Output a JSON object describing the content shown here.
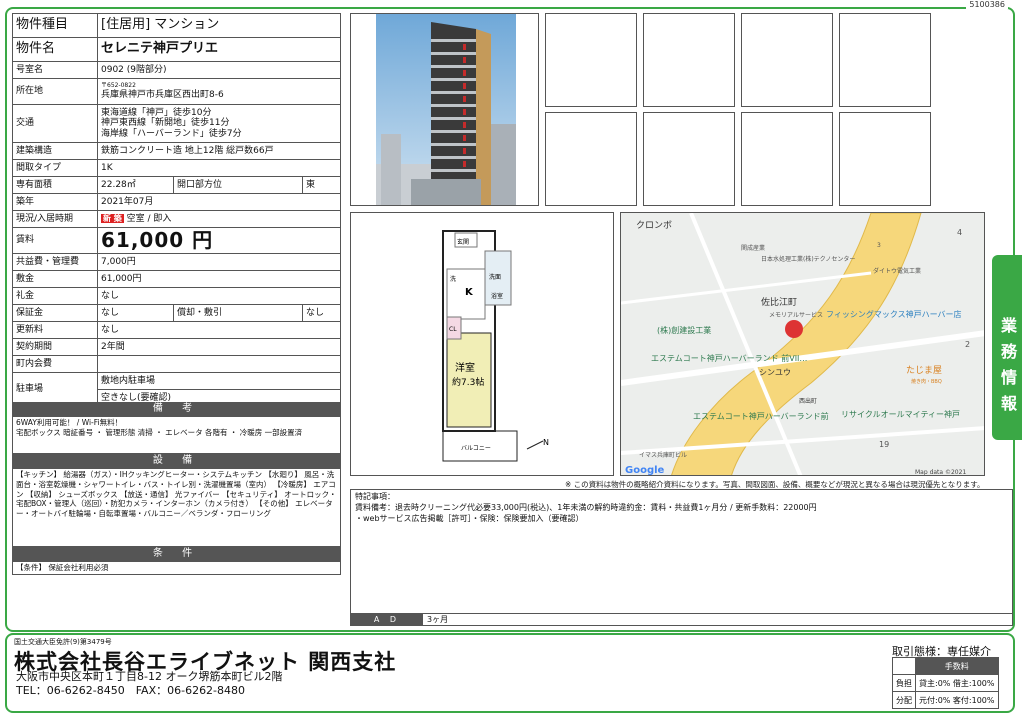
{
  "doc_id": "5100386",
  "property": {
    "type_label": "物件種目",
    "type_value": "[住居用] マンション",
    "name_label": "物件名",
    "name_value": "セレニテ神戸プリエ",
    "room_label": "号室名",
    "room_value": "0902 (9階部分)",
    "location_label": "所在地",
    "zip": "〒652-0822",
    "address": "兵庫県神戸市兵庫区西出町8-6",
    "access_label": "交通",
    "access": [
      "東海道線「神戸」徒歩10分",
      "神戸東西線「新開地」徒歩11分",
      "海岸線「ハーバーランド」徒歩7分"
    ],
    "structure_label": "建築構造",
    "structure_value": "鉄筋コンクリート造 地上12階 総戸数66戸",
    "layout_label": "間取タイプ",
    "layout_value": "1K",
    "area_label": "専有面積",
    "area_value": "22.28㎡",
    "direction_label": "開口部方位",
    "direction_value": "東",
    "built_label": "築年",
    "built_value": "2021年07月",
    "status_label": "現況/入居時期",
    "status_badge": "新 築",
    "status_value": "空室 / 即入",
    "rent_label": "賃料",
    "rent_value": "61,000 円",
    "common_label": "共益費・管理費",
    "common_value": "7,000円",
    "deposit_label": "敷金",
    "deposit_value": "61,000円",
    "key_money_label": "礼金",
    "key_money_value": "なし",
    "guarantee_label": "保証金",
    "guarantee_value": "なし",
    "amort_label": "償却・敷引",
    "amort_value": "なし",
    "renewal_label": "更新料",
    "renewal_value": "なし",
    "contract_label": "契約期間",
    "contract_value": "2年間",
    "town_fee_label": "町内会費",
    "town_fee_value": "",
    "parking_label": "駐車場",
    "parking_value1": "敷地内駐車場",
    "parking_value2": "空きなし(要確認)"
  },
  "remarks": {
    "title": "備 考",
    "text": "6WAY利用可能！ / Wi-Fi無料！\n宅配ボックス 暗証番号 ・ 管理形態 清掃 ・ エレベータ 各階有 ・ 冷暖房 一部設置済"
  },
  "facilities": {
    "title": "設 備",
    "text": "【キッチン】 給湯器（ガス）・IHクッキングヒーター・システムキッチン 【水廻り】 風呂・洗面台・浴室乾燥機・シャワートイレ・バス・トイレ別・洗濯機置場（室内） 【冷暖房】 エアコン 【収納】 シューズボックス 【放送・通信】 光ファイバー 【セキュリティ】 オートロック・宅配BOX・管理人（巡回）・防犯カメラ・インターホン（カメラ付き） 【その他】 エレベーター・オートバイ駐輪場・自転車置場・バルコニー／ベランダ・フローリング"
  },
  "conditions": {
    "title": "条 件",
    "text": "【条件】 保証会社利用必須"
  },
  "floorplan": {
    "entrance": "玄関",
    "kitchen": "K",
    "wash": "洗",
    "cl": "CL",
    "bath": "浴室",
    "washroom": "洗面",
    "room": "洋室",
    "room_size": "約7.3帖",
    "balcony": "バルコニー",
    "north": "N"
  },
  "map": {
    "labels": [
      "クロンボ",
      "関成産業",
      "日本水処理工業(株)テクノセンター",
      "ダイトウ電気工業",
      "佐比江町",
      "メモリアルサービス",
      "フィッシングマックス神戸ハーバー店",
      "(株)創建設工業",
      "エステムコート神戸ハーバーランド 前VII…",
      "シンユウ",
      "たじま屋",
      "焼き肉・BBQ",
      "西出町",
      "リサイクルオールマイティー神戸",
      "エステムコート神戸ハーバーランド前",
      "イマス兵庫町ビル"
    ],
    "route_no": "3",
    "num4": "4",
    "num2": "2",
    "num19": "19",
    "google": "Google",
    "copyright": "Map data ©2021"
  },
  "disclaimer": "※ この資料は物件の概略紹介資料になります。写真、間取図面、設備、概要などが現況と異なる場合は現況優先となります。",
  "special_notes": {
    "title": "特記事項：",
    "line1": "賃料備考：退去時クリーニング代必要33,000円(税込)、1年未満の解約時違約金：賃料・共益費1ヶ月分 / 更新手数料：22000円",
    "line2": "・webサービス広告掲載［許可］・保険：保険要加入（要確認）"
  },
  "ad": {
    "label": "A D",
    "value": "3ヶ月"
  },
  "side_tab": "業務情報",
  "footer": {
    "license": "国土交通大臣免許(9)第3479号",
    "company": "株式会社長谷エライブネット 関西支社",
    "address": "大阪市中央区本町１丁目8-12 オーク堺筋本町ビル2階",
    "tel": "TEL：06-6262-8450　FAX：06-6262-8480",
    "deal": "取引態様：専任媒介",
    "fee_title": "手数料",
    "burden_label": "負担",
    "burden_value": "貸主:0% 借主:100%",
    "split_label": "分配",
    "split_value": "元付:0% 客付:100%"
  }
}
